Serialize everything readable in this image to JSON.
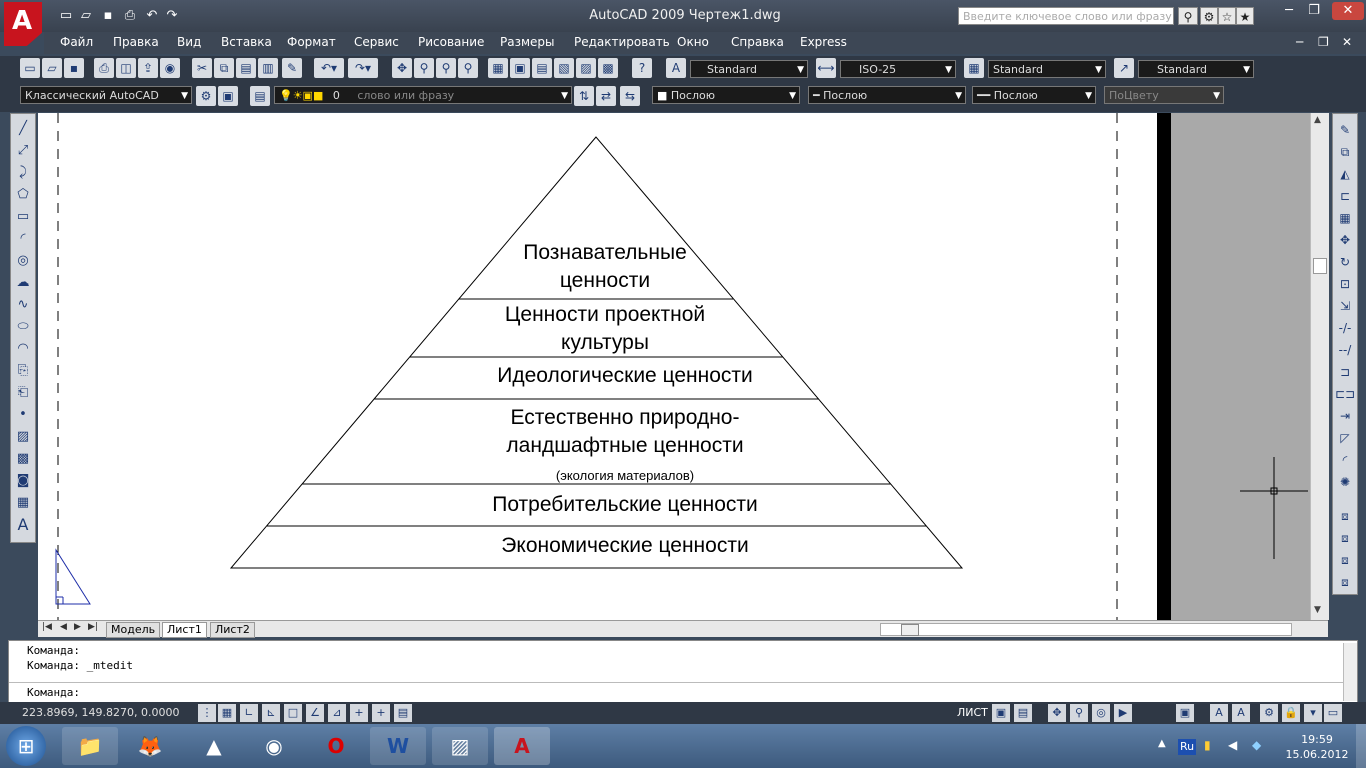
{
  "title_bar": {
    "app_title": "AutoCAD 2009  Чертеж1.dwg",
    "search_placeholder": "Введите ключевое слово или фразу"
  },
  "menu": [
    "Файл",
    "Правка",
    "Вид",
    "Вставка",
    "Формат",
    "Сервис",
    "Рисование",
    "Размеры",
    "Редактировать",
    "Окно",
    "Справка",
    "Express"
  ],
  "styles_toolbar": {
    "text_style": "Standard",
    "dim_style": "ISO-25",
    "table_style": "Standard",
    "mleader_style": "Standard"
  },
  "workspace": {
    "workspace_name": "Классический AutoCAD",
    "layer_name": "0",
    "layer_hint": "слово или фразу",
    "color_value": "Послою",
    "linetype_value": "Послою",
    "lineweight_value": "Послою",
    "plotstyle_value": "ПоЦвету"
  },
  "pyramid_levels": [
    {
      "line1": "Познавательные",
      "line2": "ценности"
    },
    {
      "line1": "Ценности проектной",
      "line2": "культуры"
    },
    {
      "line1": "Идеологические ценности"
    },
    {
      "line1": "Естественно природно-",
      "line2": "ландшафтные ценности",
      "note": "(экология материалов)"
    },
    {
      "line1": "Потребительские ценности"
    },
    {
      "line1": "Экономические ценности"
    }
  ],
  "layout_tabs": [
    "Модель",
    "Лист1",
    "Лист2"
  ],
  "command_lines": [
    "Команда:",
    "Команда:  _mtedit",
    "Команда:"
  ],
  "status_bar": {
    "coordinates": "223.8969, 149.8270, 0.0000",
    "space_label": "ЛИСТ"
  },
  "taskbar": {
    "language": "Ru",
    "time": "19:59",
    "date": "15.06.2012"
  }
}
